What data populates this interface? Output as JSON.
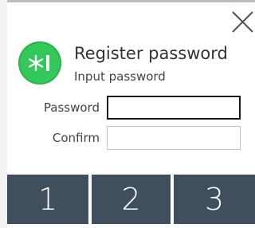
{
  "dialog": {
    "title": "Register password",
    "subtitle": "Input password",
    "close_icon": "close-icon",
    "app_icon": "password-key-icon",
    "accent_color": "#34c759"
  },
  "form": {
    "password_label": "Password",
    "password_value": "",
    "confirm_label": "Confirm",
    "confirm_value": ""
  },
  "keypad": {
    "keys": [
      "1",
      "2",
      "3"
    ],
    "key_color": "#3f4f5e"
  }
}
